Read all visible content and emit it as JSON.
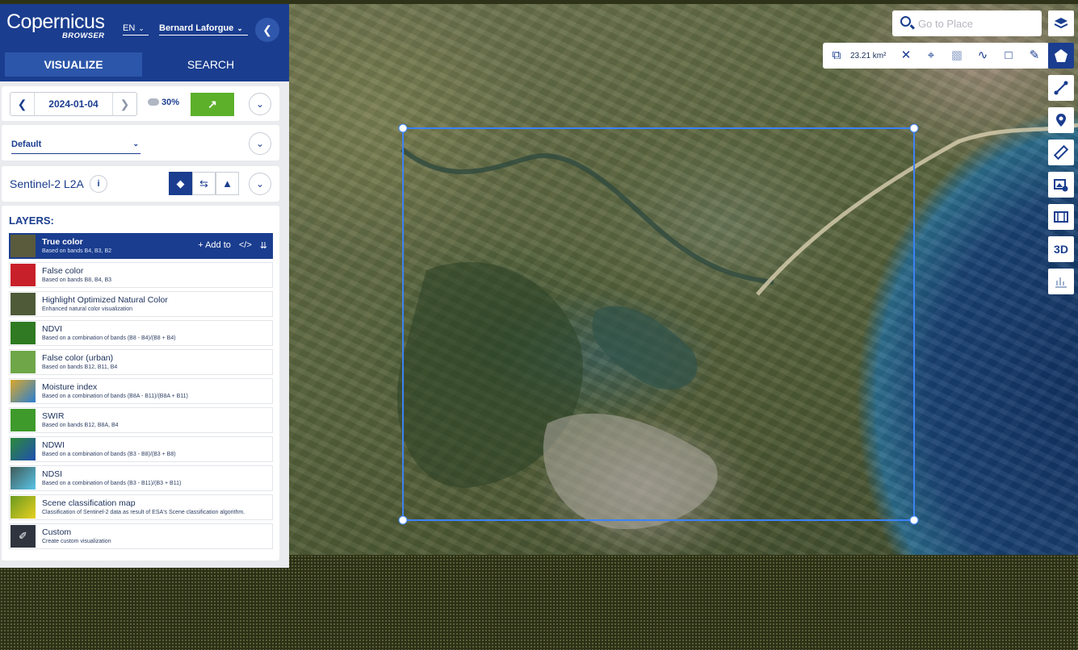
{
  "header": {
    "logo_main": "Copernicus",
    "logo_sub": "BROWSER",
    "language": "EN",
    "user": "Bernard Laforgue",
    "tabs": [
      {
        "label": "VISUALIZE",
        "active": true
      },
      {
        "label": "SEARCH",
        "active": false
      }
    ]
  },
  "date_panel": {
    "date": "2024-01-04",
    "cloud_coverage": "30%"
  },
  "preset": {
    "selected": "Default"
  },
  "dataset": {
    "name": "Sentinel-2 L2A"
  },
  "layers": {
    "heading": "LAYERS:",
    "add_to_label": "Add to",
    "items": [
      {
        "title": "True color",
        "desc": "Based on bands B4, B3, B2",
        "active": true,
        "thumb": "#5a5a3c"
      },
      {
        "title": "False color",
        "desc": "Based on bands B8, B4, B3",
        "active": false,
        "thumb": "#c8202a"
      },
      {
        "title": "Highlight Optimized Natural Color",
        "desc": "Enhanced natural color visualization",
        "active": false,
        "thumb": "#4f5a38"
      },
      {
        "title": "NDVI",
        "desc": "Based on a combination of bands (B8 - B4)/(B8 + B4)",
        "active": false,
        "thumb": "#2f7a22"
      },
      {
        "title": "False color (urban)",
        "desc": "Based on bands B12, B11, B4",
        "active": false,
        "thumb": "#6ea648"
      },
      {
        "title": "Moisture index",
        "desc": "Based on a combination of bands (B8A - B11)/(B8A + B11)",
        "active": false,
        "thumb": "#d9a72c"
      },
      {
        "title": "SWIR",
        "desc": "Based on bands B12, B8A, B4",
        "active": false,
        "thumb": "#3f9a2c"
      },
      {
        "title": "NDWI",
        "desc": "Based on a combination of bands (B3 - B8)/(B3 + B8)",
        "active": false,
        "thumb": "#2d8a3a"
      },
      {
        "title": "NDSI",
        "desc": "Based on a combination of bands (B3 - B11)/(B3 + B11)",
        "active": false,
        "thumb": "#3f5a58"
      },
      {
        "title": "Scene classification map",
        "desc": "Classification of Sentinel-2 data as result of ESA's Scene classification algorithm.",
        "active": false,
        "thumb": "#6a9a20"
      },
      {
        "title": "Custom",
        "desc": "Create custom visualization",
        "active": false,
        "thumb": "#2f343f"
      }
    ]
  },
  "map": {
    "search_placeholder": "Go to Place",
    "aoi_area": "23.21 km²"
  },
  "colors": {
    "brand": "#1a3d8f",
    "accent_green": "#5cb02a",
    "aoi_stroke": "#3b82f6"
  }
}
